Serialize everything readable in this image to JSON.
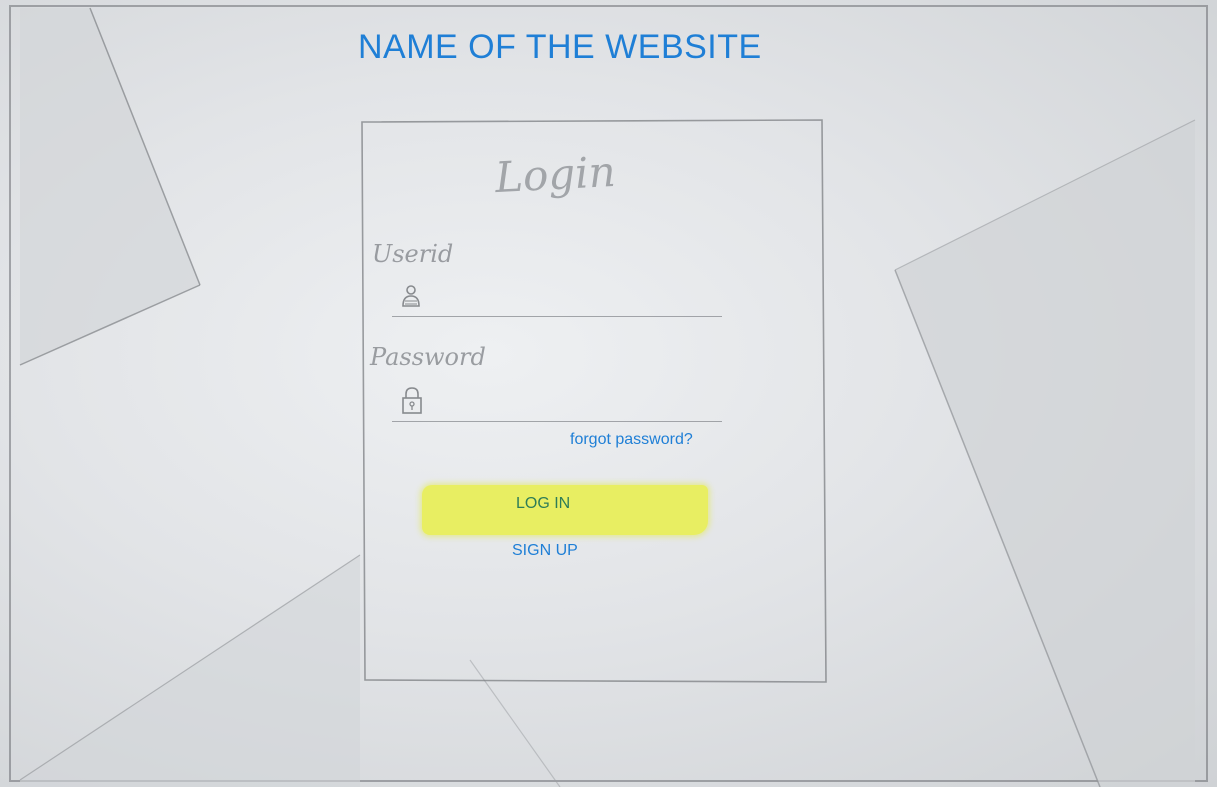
{
  "header": {
    "site_title": "NAME OF THE WEBSITE"
  },
  "login": {
    "heading": "Login",
    "userid_label": "Userid",
    "userid_value": "",
    "password_label": "Password",
    "password_value": "",
    "forgot_password_label": "forgot password?",
    "login_button_label": "LOG IN",
    "signup_label": "SIGN UP"
  },
  "icons": {
    "user": "user-icon",
    "lock": "lock-icon"
  },
  "colors": {
    "link_blue": "#1f7fd6",
    "highlight_yellow": "#e8ee62",
    "button_text_green": "#2e7d57"
  }
}
